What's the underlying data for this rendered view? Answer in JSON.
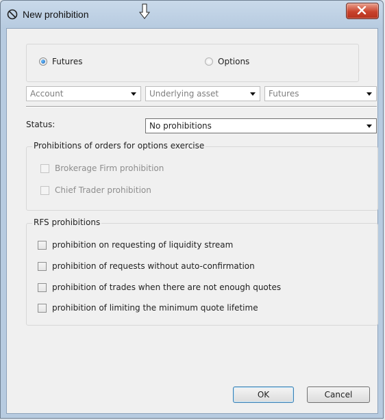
{
  "window": {
    "title": "New prohibition",
    "close_label": "x"
  },
  "type_selector": {
    "options": [
      "Futures",
      "Options"
    ],
    "selected": "Futures"
  },
  "filters": {
    "account": "Account",
    "underlying_asset": "Underlying asset",
    "instrument": "Futures"
  },
  "status": {
    "label": "Status:",
    "value": "No prohibitions"
  },
  "options_exercise_group": {
    "title": "Prohibitions of orders for  options exercise",
    "items": [
      "Brokerage Firm prohibition",
      "Chief Trader prohibition"
    ]
  },
  "rfs_group": {
    "title": "RFS prohibitions",
    "items": [
      "prohibition on requesting of liquidity stream",
      "prohibition of requests  without auto-confirmation",
      "prohibition of trades when there are not enough quotes",
      "prohibition of limiting the minimum quote lifetime"
    ]
  },
  "buttons": {
    "ok": "OK",
    "cancel": "Cancel"
  },
  "icons": {
    "title": "prohibited-icon",
    "cursor": "resize-cursor-icon",
    "close": "close-icon",
    "dropdown": "chevron-down-icon"
  }
}
